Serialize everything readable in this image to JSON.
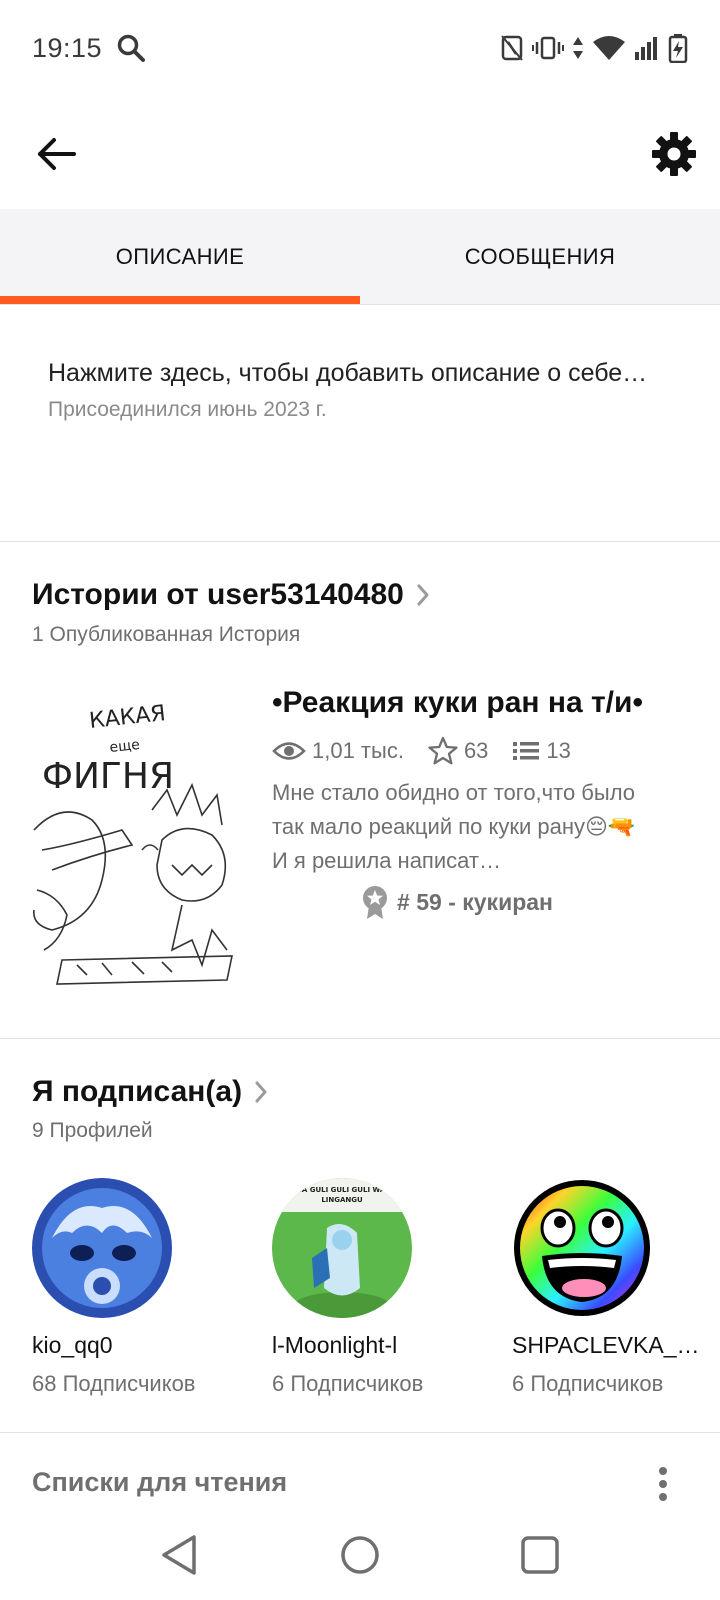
{
  "status_bar": {
    "time": "19:15",
    "icons": [
      "search-icon",
      "nfc-icon",
      "vibrate-icon",
      "data-arrows-icon",
      "wifi-icon",
      "signal-icon",
      "battery-icon"
    ]
  },
  "app_bar": {
    "back_icon": "arrow-left-icon",
    "settings_icon": "gear-icon"
  },
  "tabs": [
    {
      "label": "ОПИСАНИЕ",
      "active": true
    },
    {
      "label": "СООБЩЕНИЯ",
      "active": false
    }
  ],
  "accent_color": "#ff5a1f",
  "about": {
    "description_prompt": "Нажмите здесь, чтобы добавить описание о себе…",
    "joined": "Присоединился июнь 2023 г."
  },
  "stories_section": {
    "title": "Истории от user53140480",
    "subtitle": "1 Опубликованная История",
    "story": {
      "cover_text": "КАКАЯ еще ФИГНЯ",
      "title": "•Реакция куки ран на т/и•",
      "reads": "1,01 тыс.",
      "votes": "63",
      "parts": "13",
      "blurb": "Мне стало обидно от того,что было так мало реакций по куки рану😔🔫И я решила написат…",
      "rank": "# 59 - кукиран"
    }
  },
  "following_section": {
    "title": "Я подписан(а)",
    "subtitle": "9 Профилей",
    "profiles": [
      {
        "name": "kio_qq0",
        "followers": "68 Подписчиков"
      },
      {
        "name": "l-Moonlight-l",
        "followers": "6 Подписчиков",
        "avatar_caption": "LINGA GULI GULI GULI WANTA LINGANGU"
      },
      {
        "name": "SHPACLEVKA_K…",
        "followers": "6 Подписчиков"
      }
    ]
  },
  "reading_lists": {
    "title": "Списки для чтения"
  },
  "nav_bar": {
    "icons": [
      "nav-back-icon",
      "nav-home-icon",
      "nav-recents-icon"
    ]
  }
}
